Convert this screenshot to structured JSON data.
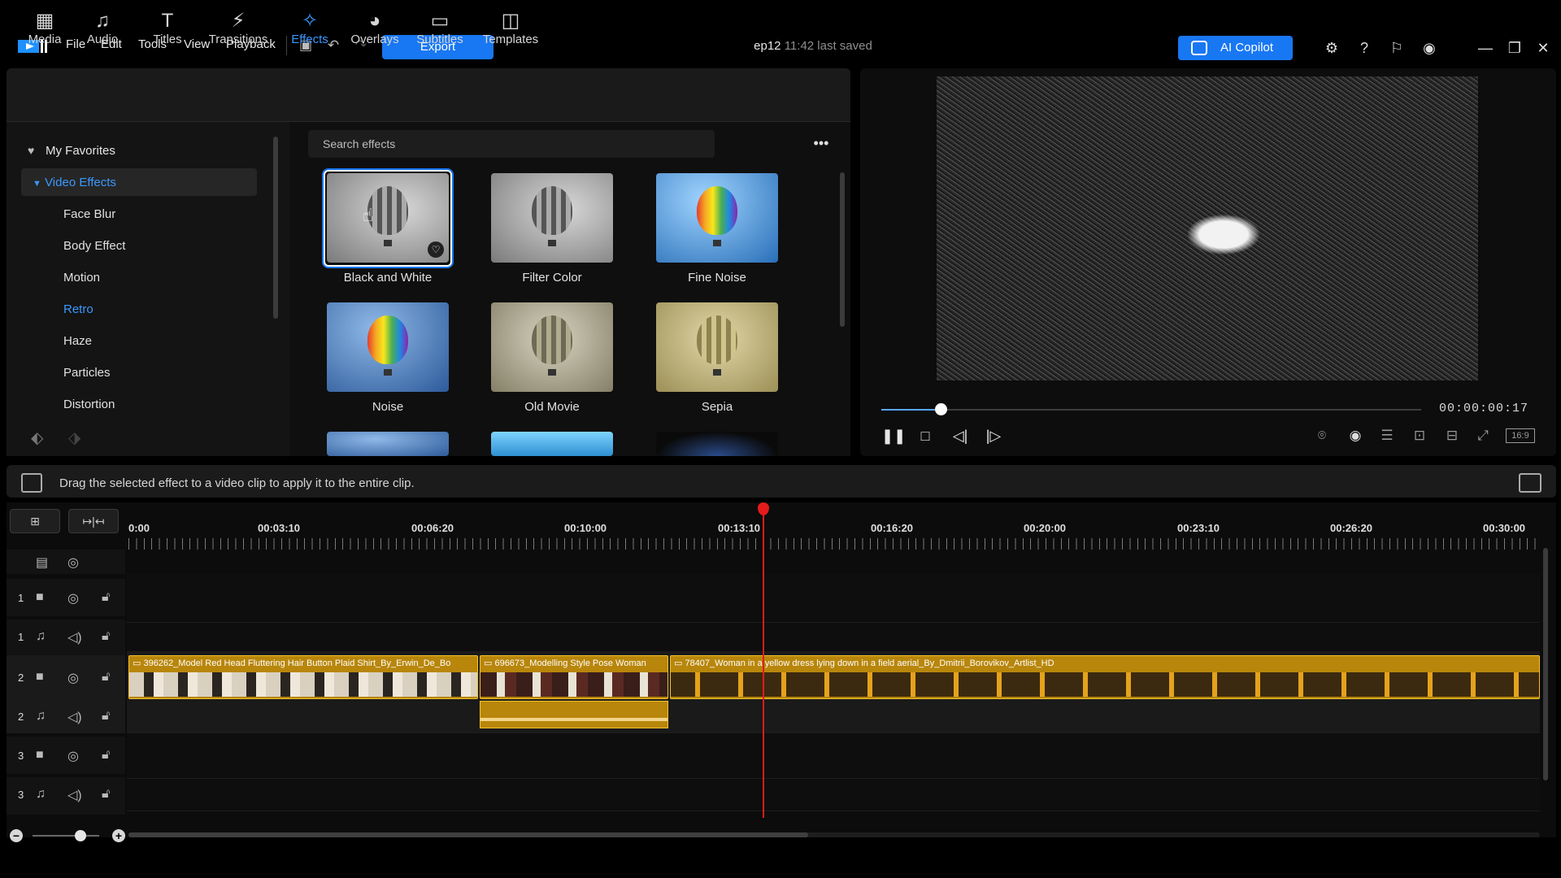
{
  "app": {
    "menus": [
      "File",
      "Edit",
      "Tools",
      "View",
      "Playback"
    ],
    "export_label": "Export",
    "project_name": "ep12",
    "project_saved": "11:42 last saved",
    "copilot_label": "AI Copilot"
  },
  "library": {
    "tabs": [
      {
        "label": "Media",
        "icon": "media-icon"
      },
      {
        "label": "Audio",
        "icon": "music-note-icon"
      },
      {
        "label": "Titles",
        "icon": "text-t-icon"
      },
      {
        "label": "Transitions",
        "icon": "transition-icon"
      },
      {
        "label": "Effects",
        "icon": "effects-icon",
        "active": true
      },
      {
        "label": "Overlays",
        "icon": "overlay-icon"
      },
      {
        "label": "Subtitles",
        "icon": "subtitles-icon"
      },
      {
        "label": "Templates",
        "icon": "templates-icon"
      }
    ],
    "tree": {
      "favorites": "My Favorites",
      "category": "Video Effects",
      "items": [
        "Face Blur",
        "Body Effect",
        "Motion",
        "Retro",
        "Haze",
        "Particles",
        "Distortion"
      ],
      "active_item": "Retro"
    },
    "search_placeholder": "Search effects",
    "effects": [
      "Black and White",
      "Filter Color",
      "Fine Noise",
      "Noise",
      "Old Movie",
      "Sepia"
    ],
    "selected_effect": "Black and White"
  },
  "preview": {
    "timecode": "00:00:00:17",
    "progress_fraction": 0.11,
    "aspect_label": "16:9"
  },
  "info": {
    "hint": "Drag the selected effect to a video clip to apply it to the entire clip."
  },
  "timeline": {
    "ruler": [
      "0:00",
      "00:03:10",
      "00:06:20",
      "00:10:00",
      "00:13:10",
      "00:16:20",
      "00:20:00",
      "00:23:10",
      "00:26:20",
      "00:30:00"
    ],
    "tracks": [
      {
        "num": "1",
        "type": "video"
      },
      {
        "num": "1",
        "type": "audio"
      },
      {
        "num": "2",
        "type": "video"
      },
      {
        "num": "2",
        "type": "audio"
      },
      {
        "num": "3",
        "type": "video"
      },
      {
        "num": "3",
        "type": "audio"
      }
    ],
    "clips": [
      "396262_Model Red Head Fluttering Hair Button Plaid Shirt_By_Erwin_De_Bo",
      "696673_Modelling Style Pose Woman",
      "78407_Woman in a yellow dress lying down in a field aerial_By_Dmitrii_Borovikov_Artlist_HD"
    ]
  },
  "colors": {
    "accent": "#1877f2",
    "active_text": "#3a98ff",
    "clip": "#b8860b",
    "playhead": "#e51b1b"
  }
}
